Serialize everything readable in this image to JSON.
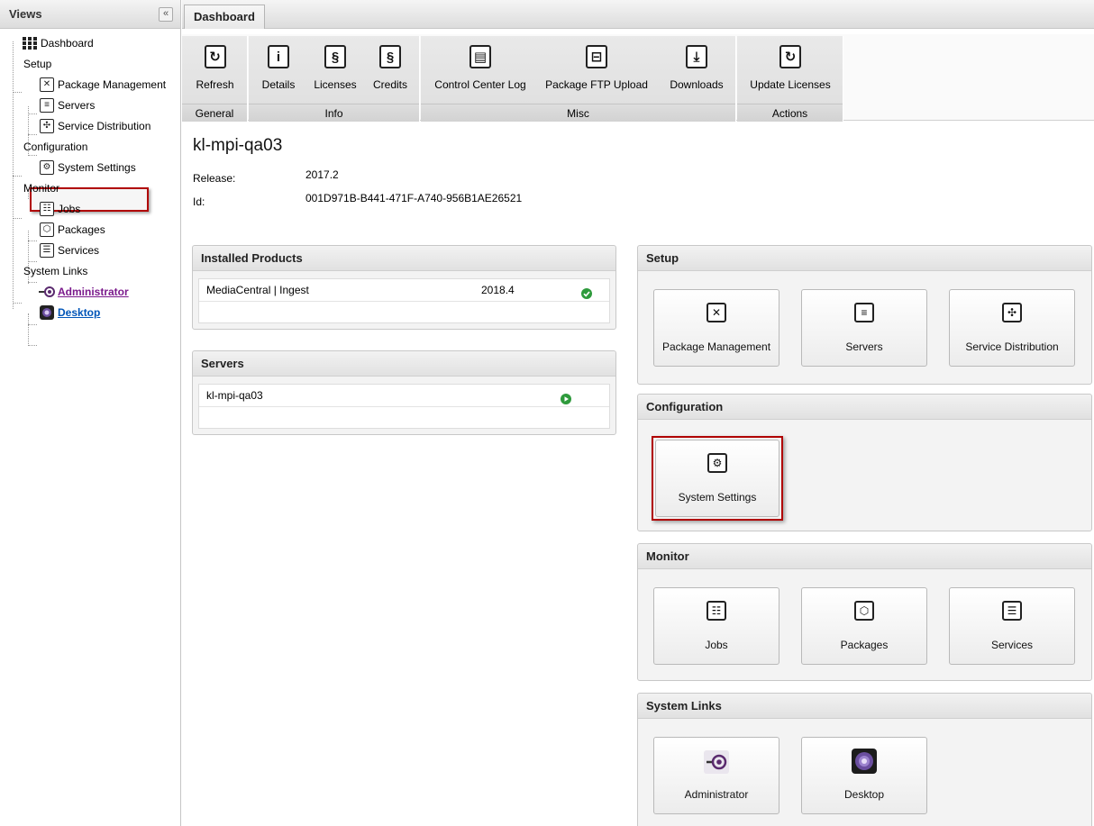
{
  "sidebar": {
    "title": "Views",
    "collapse_glyph": "«",
    "items": [
      {
        "label": "Dashboard",
        "icon": "grid-icon"
      },
      {
        "label": "Setup"
      },
      {
        "label": "Package Management",
        "icon": "tools-icon"
      },
      {
        "label": "Servers",
        "icon": "server-icon"
      },
      {
        "label": "Service Distribution",
        "icon": "distribution-icon"
      },
      {
        "label": "Configuration"
      },
      {
        "label": "System Settings",
        "icon": "gear-icon"
      },
      {
        "label": "Monitor"
      },
      {
        "label": "Jobs",
        "icon": "jobs-icon"
      },
      {
        "label": "Packages",
        "icon": "package-icon"
      },
      {
        "label": "Services",
        "icon": "services-icon"
      },
      {
        "label": "System Links"
      },
      {
        "label": "Administrator",
        "icon": "administrator-icon"
      },
      {
        "label": "Desktop",
        "icon": "desktop-icon"
      }
    ]
  },
  "tabs": [
    {
      "label": "Dashboard"
    }
  ],
  "toolbar": {
    "groups": [
      {
        "label": "General",
        "buttons": [
          {
            "label": "Refresh",
            "icon": "refresh-icon"
          }
        ]
      },
      {
        "label": "Info",
        "buttons": [
          {
            "label": "Details",
            "icon": "info-icon"
          },
          {
            "label": "Licenses",
            "icon": "section-icon"
          },
          {
            "label": "Credits",
            "icon": "section-icon"
          }
        ]
      },
      {
        "label": "Misc",
        "buttons": [
          {
            "label": "Control Center Log",
            "icon": "log-icon"
          },
          {
            "label": "Package FTP Upload",
            "icon": "upload-icon"
          },
          {
            "label": "Downloads",
            "icon": "download-icon"
          }
        ]
      },
      {
        "label": "Actions",
        "buttons": [
          {
            "label": "Update Licenses",
            "icon": "refresh-icon"
          }
        ]
      }
    ]
  },
  "host": {
    "name": "kl-mpi-qa03",
    "release_label": "Release:",
    "release": "2017.2",
    "id_label": "Id:",
    "id": "001D971B-B441-471F-A740-956B1AE26521"
  },
  "installed_products": {
    "title": "Installed Products",
    "rows": [
      {
        "name": "MediaCentral | Ingest",
        "version": "2018.4",
        "status": "ok"
      }
    ]
  },
  "servers": {
    "title": "Servers",
    "rows": [
      {
        "name": "kl-mpi-qa03",
        "status": "running"
      }
    ]
  },
  "sections": {
    "setup": {
      "title": "Setup",
      "cards": [
        {
          "label": "Package Management",
          "icon": "tools-icon"
        },
        {
          "label": "Servers",
          "icon": "server-icon"
        },
        {
          "label": "Service Distribution",
          "icon": "distribution-icon"
        }
      ]
    },
    "configuration": {
      "title": "Configuration",
      "cards": [
        {
          "label": "System Settings",
          "icon": "gear-icon"
        }
      ]
    },
    "monitor": {
      "title": "Monitor",
      "cards": [
        {
          "label": "Jobs",
          "icon": "jobs-icon"
        },
        {
          "label": "Packages",
          "icon": "package-icon"
        },
        {
          "label": "Services",
          "icon": "services-icon"
        }
      ]
    },
    "system_links": {
      "title": "System Links",
      "cards": [
        {
          "label": "Administrator",
          "icon": "administrator-icon"
        },
        {
          "label": "Desktop",
          "icon": "desktop-icon"
        }
      ]
    }
  },
  "colors": {
    "highlight": "#b00000",
    "link": "#0055b8",
    "link_visited": "#7b1a8c",
    "status_ok": "#2e9a3c"
  }
}
